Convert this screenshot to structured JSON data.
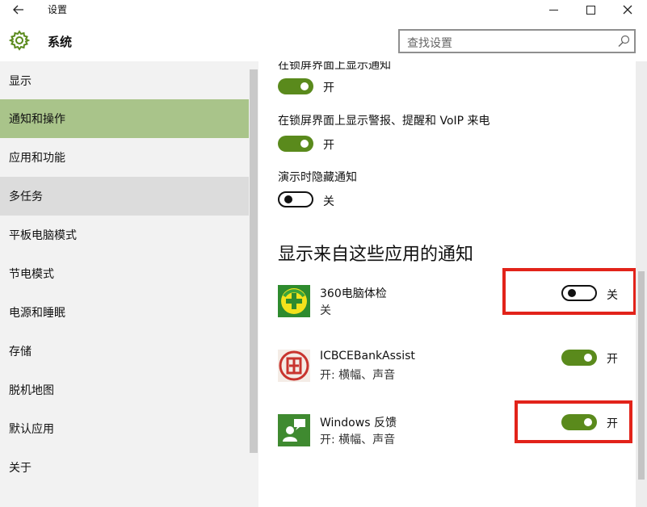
{
  "window": {
    "title": "设置",
    "back_icon": "back-arrow-icon",
    "minimize_icon": "minimize-icon",
    "maximize_icon": "maximize-icon",
    "close_icon": "close-icon"
  },
  "header": {
    "title": "系统",
    "icon": "gear-icon",
    "accent": "#5a8a1c",
    "search_placeholder": "查找设置",
    "search_icon": "search-icon"
  },
  "sidebar": {
    "items": [
      {
        "label": "显示"
      },
      {
        "label": "通知和操作",
        "state": "selected"
      },
      {
        "label": "应用和功能"
      },
      {
        "label": "多任务",
        "state": "hover"
      },
      {
        "label": "平板电脑模式"
      },
      {
        "label": "节电模式"
      },
      {
        "label": "电源和睡眠"
      },
      {
        "label": "存储"
      },
      {
        "label": "脱机地图"
      },
      {
        "label": "默认应用"
      },
      {
        "label": "关于"
      }
    ],
    "selected_color": "#a9c48a"
  },
  "options": [
    {
      "label": "在锁屏界面上显示通知",
      "on": true,
      "state_label": "开"
    },
    {
      "label": "在锁屏界面上显示警报、提醒和 VoIP 来电",
      "on": true,
      "state_label": "开"
    },
    {
      "label": "演示时隐藏通知",
      "on": false,
      "state_label": "关"
    }
  ],
  "apps_section": {
    "title": "显示来自这些应用的通知",
    "apps": [
      {
        "name": "360电脑体检",
        "sub": "关",
        "on": false,
        "state_label": "关",
        "icon": "360-checkup-icon",
        "highlighted": true
      },
      {
        "name": "ICBCEBankAssist",
        "sub": "开: 横幅、声音",
        "on": true,
        "state_label": "开",
        "icon": "icbc-bank-icon",
        "highlighted": false
      },
      {
        "name": "Windows 反馈",
        "sub": "开: 横幅、声音",
        "on": true,
        "state_label": "开",
        "icon": "windows-feedback-icon",
        "highlighted": true
      }
    ]
  },
  "colors": {
    "toggle_on": "#5a8a1c",
    "highlight_box": "#e2231a"
  }
}
